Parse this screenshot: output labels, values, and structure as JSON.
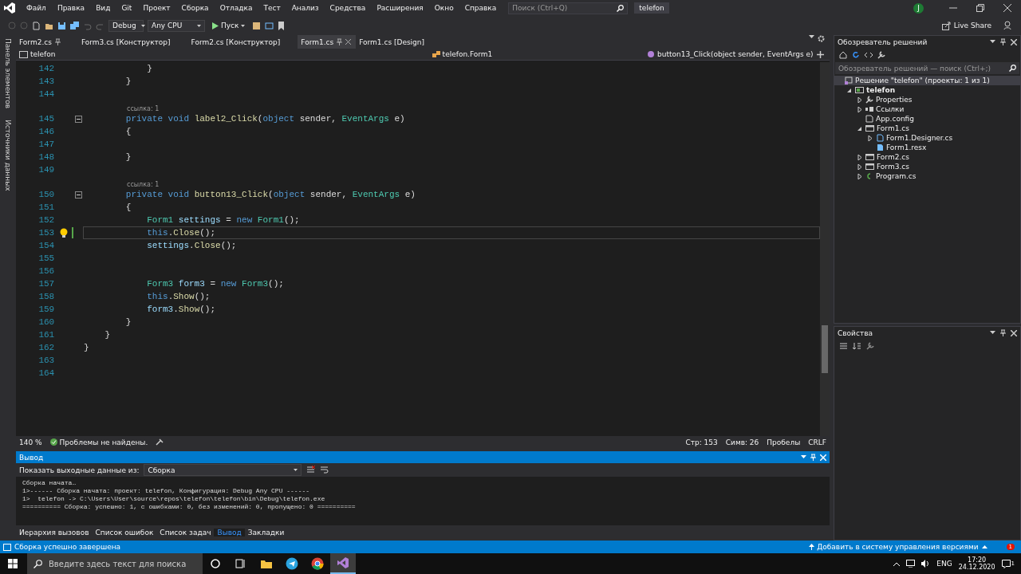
{
  "title_bar": {
    "menu": [
      "Файл",
      "Правка",
      "Вид",
      "Git",
      "Проект",
      "Сборка",
      "Отладка",
      "Тест",
      "Анализ",
      "Средства",
      "Расширения",
      "Окно",
      "Справка"
    ],
    "search": {
      "placeholder": "Поиск (Ctrl+Q)"
    },
    "solution_name": "telefon",
    "account_initial": "J"
  },
  "toolbar": {
    "configuration": "Debug",
    "platform": "Any CPU",
    "run": "Пуск",
    "live_share": "Live Share"
  },
  "side_tabs": [
    "Панель элементов",
    "Источники данных"
  ],
  "editor": {
    "tabs": [
      {
        "label": "Form2.cs",
        "selected": false,
        "pinned": true
      },
      {
        "label": "Form3.cs [Конструктор]",
        "selected": false,
        "pinned": false
      },
      {
        "label": "Form2.cs [Конструктор]",
        "selected": false,
        "pinned": false
      },
      {
        "label": "Form1.cs",
        "selected": true,
        "pinned": true
      },
      {
        "label": "Form1.cs [Design]",
        "selected": false,
        "pinned": false
      }
    ],
    "nav": {
      "project": "telefon",
      "class": "telefon.Form1",
      "member": "button13_Click(object sender, EventArgs e)"
    },
    "lines": [
      {
        "number": "142",
        "current": false,
        "fold": false,
        "lightbulb": false,
        "tokens": [
          {
            "text": "            }",
            "kind": "plain"
          }
        ]
      },
      {
        "number": "143",
        "current": false,
        "fold": false,
        "lightbulb": false,
        "tokens": [
          {
            "text": "        }",
            "kind": "plain"
          }
        ]
      },
      {
        "number": "144",
        "current": false,
        "fold": false,
        "lightbulb": false
      },
      {
        "number": "145",
        "codelens": "ссылка: 1",
        "current": false,
        "fold": true,
        "lightbulb": false,
        "tokens": [
          {
            "text": "        private void ",
            "kind": "keyword"
          },
          {
            "text": "label2_Click",
            "kind": "method"
          },
          {
            "text": "(",
            "kind": "plain"
          },
          {
            "text": "object",
            "kind": "keyword"
          },
          {
            "text": " sender, ",
            "kind": "plain"
          },
          {
            "text": "EventArgs",
            "kind": "type"
          },
          {
            "text": " e)",
            "kind": "plain"
          }
        ]
      },
      {
        "number": "146",
        "current": false,
        "fold": false,
        "lightbulb": false,
        "tokens": [
          {
            "text": "        {",
            "kind": "plain"
          }
        ]
      },
      {
        "number": "147",
        "current": false,
        "fold": false,
        "lightbulb": false
      },
      {
        "number": "148",
        "current": false,
        "fold": false,
        "lightbulb": false,
        "tokens": [
          {
            "text": "        }",
            "kind": "plain"
          }
        ]
      },
      {
        "number": "149",
        "current": false,
        "fold": false,
        "lightbulb": false
      },
      {
        "number": "150",
        "codelens": "ссылка: 1",
        "current": false,
        "fold": true,
        "lightbulb": false,
        "tokens": [
          {
            "text": "        private void ",
            "kind": "keyword"
          },
          {
            "text": "button13_Click",
            "kind": "method"
          },
          {
            "text": "(",
            "kind": "plain"
          },
          {
            "text": "object",
            "kind": "keyword"
          },
          {
            "text": " sender, ",
            "kind": "plain"
          },
          {
            "text": "EventArgs",
            "kind": "type"
          },
          {
            "text": " e)",
            "kind": "plain"
          }
        ]
      },
      {
        "number": "151",
        "current": false,
        "fold": false,
        "lightbulb": false,
        "tokens": [
          {
            "text": "        {",
            "kind": "plain"
          }
        ]
      },
      {
        "number": "152",
        "current": false,
        "fold": false,
        "lightbulb": false,
        "tokens": [
          {
            "text": "            Form1",
            "kind": "type"
          },
          {
            "text": " settings",
            "kind": "local"
          },
          {
            "text": " = ",
            "kind": "plain"
          },
          {
            "text": "new ",
            "kind": "keyword"
          },
          {
            "text": "Form1",
            "kind": "type"
          },
          {
            "text": "();",
            "kind": "plain"
          }
        ]
      },
      {
        "number": "153",
        "current": true,
        "fold": false,
        "lightbulb": true,
        "tokens": [
          {
            "text": "            this",
            "kind": "keyword"
          },
          {
            "text": ".",
            "kind": "plain"
          },
          {
            "text": "Close",
            "kind": "method"
          },
          {
            "text": "();",
            "kind": "plain"
          }
        ]
      },
      {
        "number": "154",
        "current": false,
        "fold": false,
        "lightbulb": false,
        "tokens": [
          {
            "text": "            settings",
            "kind": "local"
          },
          {
            "text": ".",
            "kind": "plain"
          },
          {
            "text": "Close",
            "kind": "method"
          },
          {
            "text": "();",
            "kind": "plain"
          }
        ]
      },
      {
        "number": "155",
        "current": false,
        "fold": false,
        "lightbulb": false
      },
      {
        "number": "156",
        "current": false,
        "fold": false,
        "lightbulb": false
      },
      {
        "number": "157",
        "current": false,
        "fold": false,
        "lightbulb": false,
        "tokens": [
          {
            "text": "            Form3",
            "kind": "type"
          },
          {
            "text": " form3",
            "kind": "local"
          },
          {
            "text": " = ",
            "kind": "plain"
          },
          {
            "text": "new ",
            "kind": "keyword"
          },
          {
            "text": "Form3",
            "kind": "type"
          },
          {
            "text": "();",
            "kind": "plain"
          }
        ]
      },
      {
        "number": "158",
        "current": false,
        "fold": false,
        "lightbulb": false,
        "tokens": [
          {
            "text": "            this",
            "kind": "keyword"
          },
          {
            "text": ".",
            "kind": "plain"
          },
          {
            "text": "Show",
            "kind": "method"
          },
          {
            "text": "();",
            "kind": "plain"
          }
        ]
      },
      {
        "number": "159",
        "current": false,
        "fold": false,
        "lightbulb": false,
        "tokens": [
          {
            "text": "            form3",
            "kind": "local"
          },
          {
            "text": ".",
            "kind": "plain"
          },
          {
            "text": "Show",
            "kind": "method"
          },
          {
            "text": "();",
            "kind": "plain"
          }
        ]
      },
      {
        "number": "160",
        "current": false,
        "fold": false,
        "lightbulb": false,
        "tokens": [
          {
            "text": "        }",
            "kind": "plain"
          }
        ]
      },
      {
        "number": "161",
        "current": false,
        "fold": false,
        "lightbulb": false,
        "tokens": [
          {
            "text": "    }",
            "kind": "plain"
          }
        ]
      },
      {
        "number": "162",
        "current": false,
        "fold": false,
        "lightbulb": false,
        "tokens": [
          {
            "text": "}",
            "kind": "plain"
          }
        ]
      },
      {
        "number": "163",
        "current": false,
        "fold": false,
        "lightbulb": false
      },
      {
        "number": "164",
        "current": false,
        "fold": false,
        "lightbulb": false
      }
    ],
    "status": {
      "zoom": "140 %",
      "problems": "Проблемы не найдены.",
      "row": "Стр: 153",
      "column": "Симв: 26",
      "whitespace": "Пробелы",
      "line_endings": "CRLF"
    }
  },
  "output": {
    "title": "Вывод",
    "source_label": "Показать выходные данные из:",
    "source": "Сборка",
    "lines": [
      "Сборка начата…",
      "1>------ Сборка начата: проект: telefon, Конфигурация: Debug Any CPU ------",
      "1>  telefon -> C:\\Users\\User\\source\\repos\\telefon\\telefon\\bin\\Debug\\telefon.exe",
      "========== Сборка: успешно: 1, с ошибками: 0, без изменений: 0, пропущено: 0 =========="
    ],
    "tabs": [
      {
        "label": "Иерархия вызовов",
        "selected": false
      },
      {
        "label": "Список ошибок",
        "selected": false
      },
      {
        "label": "Список задач",
        "selected": false
      },
      {
        "label": "Вывод",
        "selected": true
      },
      {
        "label": "Закладки",
        "selected": false
      }
    ]
  },
  "solution_explorer": {
    "title": "Обозреватель решений",
    "search": {
      "placeholder": "Обозреватель решений — поиск (Ctrl+;)"
    },
    "tree": [
      {
        "label": "Решение \"telefon\" (проекты: 1 из 1)",
        "kind": "solution",
        "children": [
          {
            "label": "telefon",
            "kind": "project",
            "expanded": true,
            "children": [
              {
                "label": "Properties",
                "kind": "properties",
                "expanded": false
              },
              {
                "label": "Ссылки",
                "kind": "references",
                "expanded": false
              },
              {
                "label": "App.config",
                "kind": "config"
              },
              {
                "label": "Form1.cs",
                "kind": "form",
                "expanded": true,
                "children": [
                  {
                    "label": "Form1.Designer.cs",
                    "kind": "designer",
                    "expanded": false
                  },
                  {
                    "label": "Form1.resx",
                    "kind": "resx"
                  }
                ]
              },
              {
                "label": "Form2.cs",
                "kind": "form",
                "expanded": false
              },
              {
                "label": "Form3.cs",
                "kind": "form",
                "expanded": false
              },
              {
                "label": "Program.cs",
                "kind": "class",
                "expanded": false
              }
            ]
          }
        ]
      }
    ]
  },
  "properties": {
    "title": "Свойства"
  },
  "status_bar": {
    "message": "Сборка успешно завершена",
    "source_control": "Добавить в систему управления версиями",
    "notifications": "1"
  },
  "taskbar": {
    "search": {
      "placeholder": "Введите здесь текст для поиска"
    },
    "apps": [
      {
        "kind": "cortana",
        "active": false
      },
      {
        "kind": "task-view",
        "active": false
      },
      {
        "kind": "explorer",
        "active": false
      },
      {
        "kind": "telegram",
        "active": false
      },
      {
        "kind": "chrome",
        "active": false
      },
      {
        "kind": "visual-studio",
        "active": true
      }
    ],
    "language": "ENG",
    "time": "17:20",
    "date": "24.12.2020",
    "notifications": "1"
  }
}
